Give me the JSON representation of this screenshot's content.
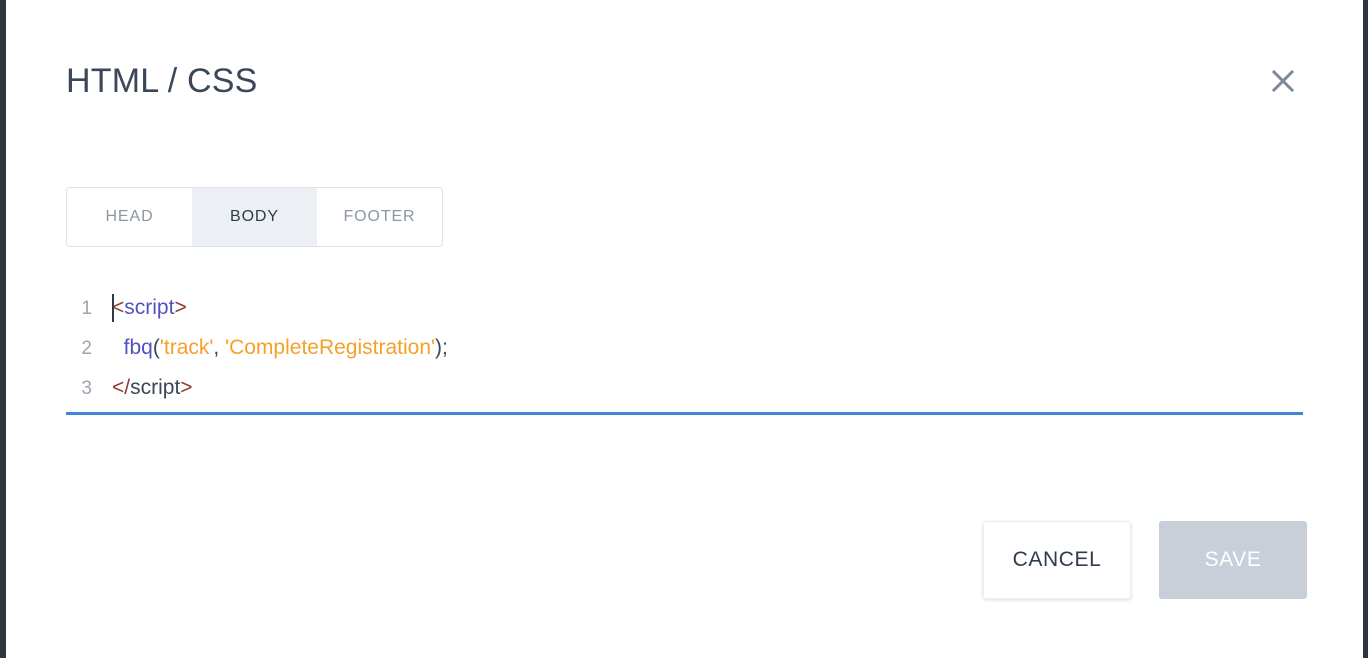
{
  "dialog": {
    "title": "HTML / CSS",
    "close_icon": "close-icon",
    "close_label": "Close"
  },
  "tabs": {
    "items": [
      {
        "label": "HEAD",
        "active": false
      },
      {
        "label": "BODY",
        "active": true
      },
      {
        "label": "FOOTER",
        "active": false
      }
    ]
  },
  "editor": {
    "language": "html",
    "caret_line": 1,
    "caret_column": 1,
    "underline_color": "#4285d8",
    "lines": [
      {
        "number": "1",
        "tokens": [
          {
            "text": "<",
            "type": "punct"
          },
          {
            "text": "script",
            "type": "tag"
          },
          {
            "text": ">",
            "type": "punct"
          }
        ]
      },
      {
        "number": "2",
        "tokens": [
          {
            "text": "  ",
            "type": "plain"
          },
          {
            "text": "fbq",
            "type": "fn"
          },
          {
            "text": "(",
            "type": "plain"
          },
          {
            "text": "'track'",
            "type": "str"
          },
          {
            "text": ", ",
            "type": "plain"
          },
          {
            "text": "'CompleteRegistration'",
            "type": "str"
          },
          {
            "text": ");",
            "type": "plain"
          }
        ]
      },
      {
        "number": "3",
        "tokens": [
          {
            "text": "</",
            "type": "punct"
          },
          {
            "text": "script",
            "type": "tag-b"
          },
          {
            "text": ">",
            "type": "punct"
          }
        ]
      }
    ]
  },
  "actions": {
    "cancel_label": "CANCEL",
    "save_label": "SAVE",
    "save_disabled": true
  },
  "colors": {
    "page_background": "#2e3440",
    "surface": "#ffffff",
    "title_text": "#3b4759",
    "tab_active_background": "#eceff3",
    "tab_inactive_text": "#8c97a4",
    "accent_underline": "#4285d8",
    "string_token": "#f5a02a",
    "tag_token": "#5151c4",
    "bracket_token": "#8b3a2a",
    "save_disabled_background": "#c8cfd8"
  }
}
